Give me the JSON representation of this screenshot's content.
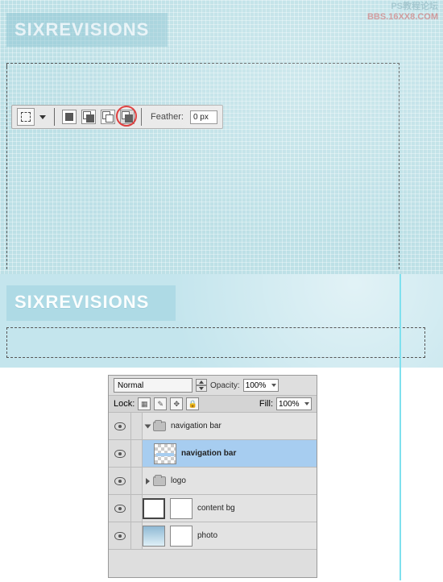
{
  "watermark": {
    "line1": "PS教程论坛",
    "line2_a": "BBS.16",
    "line2_x": "XX",
    "line2_b": "8.COM"
  },
  "logo_top": "SIXREVISIONS",
  "logo_mid": "SIXREVISIONS",
  "options": {
    "feather_label": "Feather:",
    "feather_value": "0 px"
  },
  "layers_panel": {
    "blend_mode": "Normal",
    "opacity_label": "Opacity:",
    "opacity_value": "100%",
    "lock_label": "Lock:",
    "fill_label": "Fill:",
    "fill_value": "100%",
    "layers": [
      {
        "name": "navigation bar",
        "type": "group",
        "open": true
      },
      {
        "name": "navigation bar",
        "type": "layer",
        "selected": true,
        "thumb": "checker"
      },
      {
        "name": "logo",
        "type": "group",
        "open": false
      },
      {
        "name": "content bg",
        "type": "layer",
        "thumb": "doc"
      },
      {
        "name": "photo",
        "type": "layer",
        "thumb": "sky"
      }
    ]
  }
}
